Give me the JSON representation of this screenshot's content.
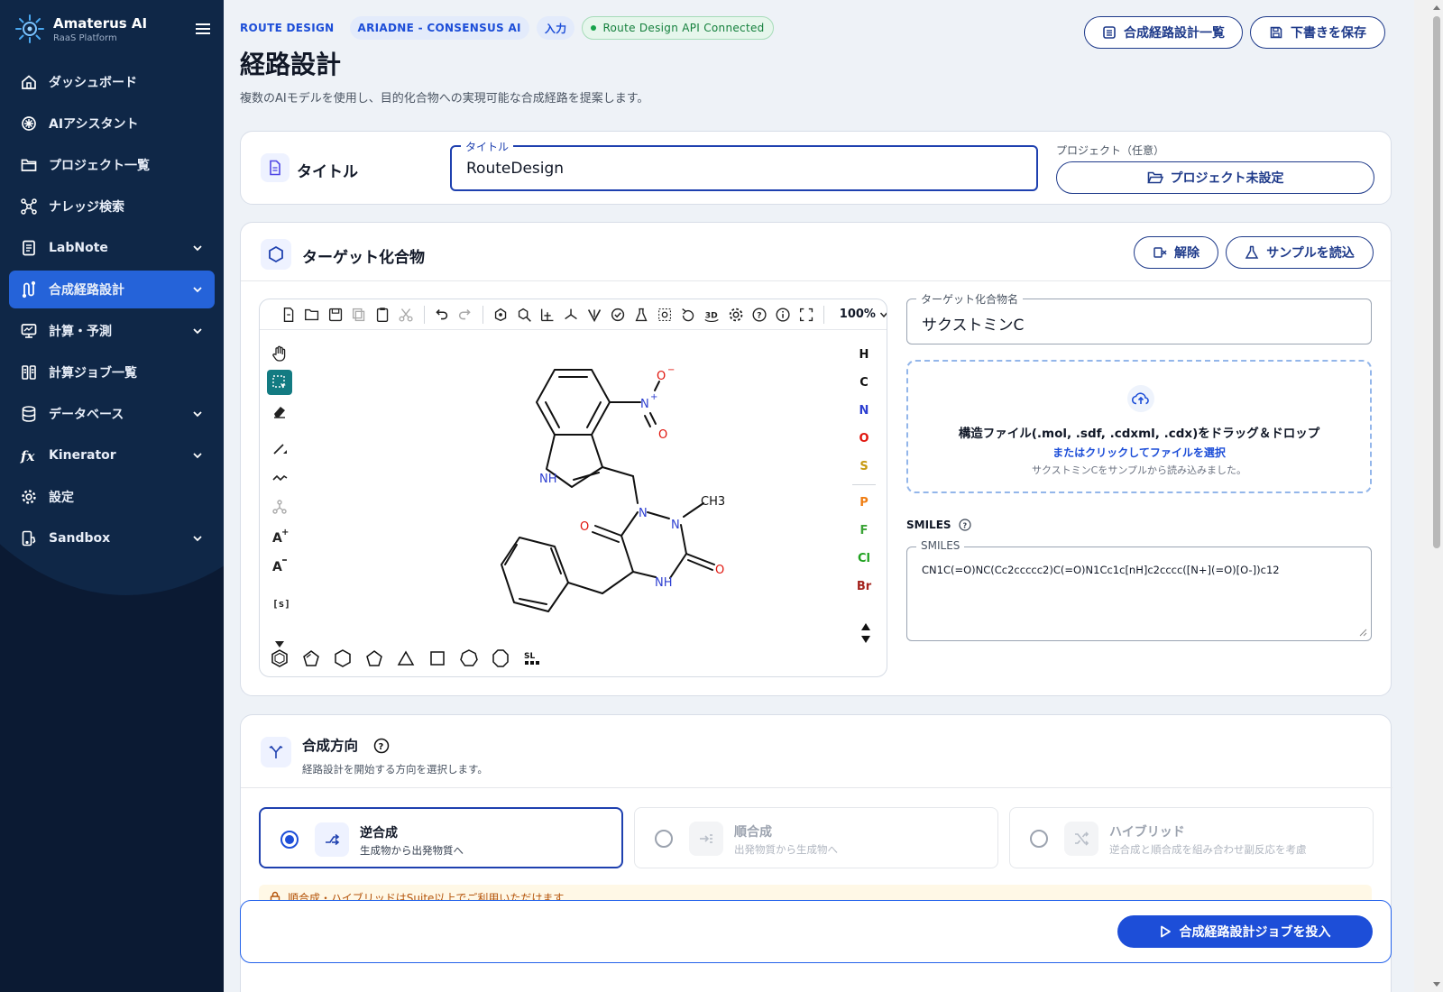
{
  "brand": {
    "name": "Amaterus AI",
    "subtitle": "RaaS Platform"
  },
  "nav": [
    {
      "label": "ダッシュボード",
      "icon": "home-icon",
      "chevron": false,
      "active": false
    },
    {
      "label": "AIアシスタント",
      "icon": "sparkle-icon",
      "chevron": false,
      "active": false
    },
    {
      "label": "プロジェクト一覧",
      "icon": "folder-icon",
      "chevron": false,
      "active": false
    },
    {
      "label": "ナレッジ検索",
      "icon": "network-icon",
      "chevron": false,
      "active": false
    },
    {
      "label": "LabNote",
      "icon": "note-icon",
      "chevron": true,
      "active": false
    },
    {
      "label": "合成経路設計",
      "icon": "route-icon",
      "chevron": true,
      "active": true
    },
    {
      "label": "計算・予測",
      "icon": "monitor-icon",
      "chevron": true,
      "active": false
    },
    {
      "label": "計算ジョブ一覧",
      "icon": "columns-icon",
      "chevron": false,
      "active": false
    },
    {
      "label": "データベース",
      "icon": "database-icon",
      "chevron": true,
      "active": false
    },
    {
      "label": "Kinerator",
      "icon": "function-icon",
      "chevron": true,
      "active": false
    },
    {
      "label": "設定",
      "icon": "gear-icon",
      "chevron": false,
      "active": false
    },
    {
      "label": "Sandbox",
      "icon": "sandbox-icon",
      "chevron": true,
      "active": false
    }
  ],
  "header": {
    "badges": [
      "ROUTE DESIGN",
      "ARIADNE - CONSENSUS AI",
      "入力"
    ],
    "status": "Route Design API Connected",
    "title": "経路設計",
    "description": "複数のAIモデルを使用し、目的化合物への実現可能な合成経路を提案します。",
    "list_button": "合成経路設計一覧",
    "save_button": "下書きを保存"
  },
  "title_card": {
    "heading": "タイトル",
    "field_label": "タイトル",
    "field_value": "RouteDesign",
    "project_label": "プロジェクト（任意）",
    "project_button": "プロジェクト未設定"
  },
  "target_card": {
    "heading": "ターゲット化合物",
    "clear_button": "解除",
    "sample_button": "サンプルを読込",
    "zoom": "100%",
    "atoms": [
      {
        "symbol": "H",
        "color": "#111111"
      },
      {
        "symbol": "C",
        "color": "#111111"
      },
      {
        "symbol": "N",
        "color": "#2d3fd1"
      },
      {
        "symbol": "O",
        "color": "#e0140c"
      },
      {
        "symbol": "S",
        "color": "#c79a10"
      },
      {
        "symbol": "P",
        "color": "#ef7d12"
      },
      {
        "symbol": "F",
        "color": "#3aa336"
      },
      {
        "symbol": "Cl",
        "color": "#1fa11f"
      },
      {
        "symbol": "Br",
        "color": "#a4241e"
      }
    ],
    "molecule_labels": {
      "o_minus": "O",
      "nplus": "N",
      "o": "O",
      "nh_indole": "NH",
      "n1": "N",
      "n2": "N",
      "ch3": "CH3",
      "o_left": "O",
      "o_right": "O",
      "nh_ring": "NH"
    },
    "name_label": "ターゲット化合物名",
    "name_value": "サクストミンC",
    "drop_main": "構造ファイル(.mol, .sdf, .cdxml, .cdx)をドラッグ＆ドロップ",
    "drop_sub": "またはクリックしてファイルを選択",
    "drop_note": "サクストミンCをサンプルから読み込みました。",
    "smiles_heading": "SMILES",
    "smiles_label": "SMILES",
    "smiles_value": "CN1C(=O)NC(Cc2ccccc2)C(=O)N1Cc1c[nH]c2cccc([N+](=O)[O-])c12"
  },
  "direction_card": {
    "heading": "合成方向",
    "description": "経路設計を開始する方向を選択します。",
    "options": [
      {
        "title": "逆合成",
        "desc": "生成物から出発物質へ"
      },
      {
        "title": "順合成",
        "desc": "出発物質から生成物へ"
      },
      {
        "title": "ハイブリッド",
        "desc": "逆合成と順合成を組み合わせ副反応を考慮"
      }
    ],
    "warning": "順合成・ハイブリッドはSuite以上でご利用いただけます"
  },
  "submit_button": "合成経路設計ジョブを投入",
  "colors": {
    "sidebar": "#0b1a33",
    "accent": "#1d4ed8",
    "active_nav": "#2563d9"
  }
}
